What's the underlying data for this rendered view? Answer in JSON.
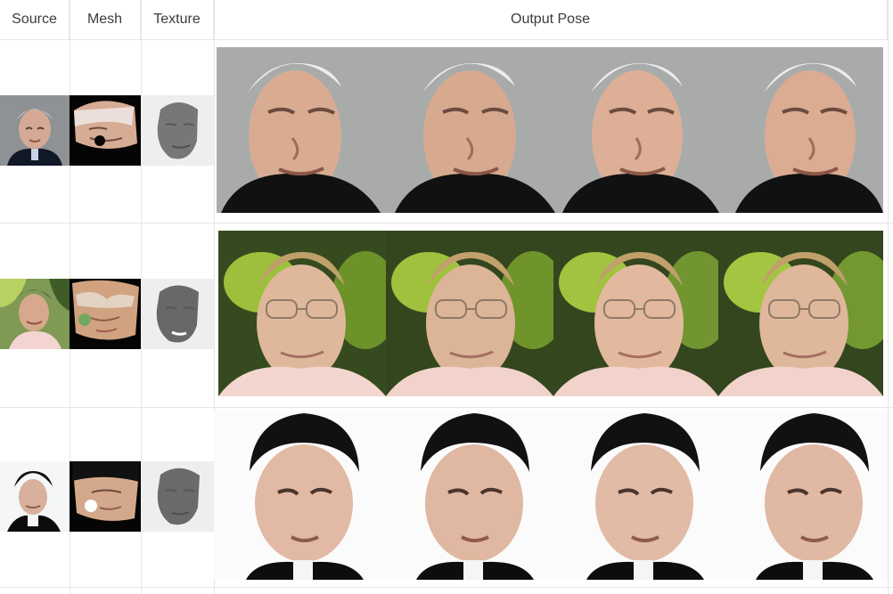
{
  "table": {
    "headers": {
      "source": "Source",
      "mesh": "Mesh",
      "texture": "Texture",
      "output_pose": "Output Pose"
    },
    "rows": [
      {
        "subject": "elderly-man",
        "source_image": "elderly-man-portrait",
        "mesh_image": "elderly-man-face-mesh",
        "texture_image": "gray-face-texture",
        "output_images": [
          "pose-1",
          "pose-2",
          "pose-3",
          "pose-4"
        ]
      },
      {
        "subject": "woman-green-background",
        "source_image": "woman-portrait",
        "mesh_image": "woman-face-mesh",
        "texture_image": "gray-face-texture",
        "output_images": [
          "pose-1",
          "pose-2",
          "pose-3",
          "pose-4"
        ]
      },
      {
        "subject": "young-man",
        "source_image": "young-man-portrait",
        "mesh_image": "young-man-face-mesh",
        "texture_image": "gray-face-texture",
        "output_images": [
          "pose-1",
          "pose-2",
          "pose-3",
          "pose-4"
        ]
      }
    ]
  },
  "colors": {
    "grid_line": "#e6e6e6",
    "header_text": "#3b3b3b",
    "gray_bg": "#a9abab",
    "green_bg": "#79a534",
    "dark_bg": "#0b0b0b",
    "white_bg": "#fbfbfb"
  }
}
